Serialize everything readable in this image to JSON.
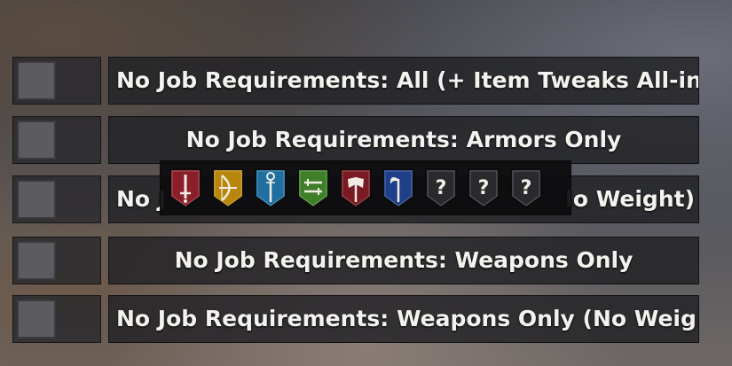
{
  "options": [
    {
      "label": "No Job Requirements: All (+ Item Tweaks All-in-",
      "align": "left",
      "checked": false
    },
    {
      "label": "No Job Requirements: Armors Only",
      "align": "center",
      "checked": false
    },
    {
      "label_left": "No J",
      "label_right": "lo Weight)",
      "checked": false
    },
    {
      "label": "No Job Requirements: Weapons Only",
      "align": "center",
      "checked": false
    },
    {
      "label": "No Job Requirements: Weapons Only (No Weigl",
      "align": "left",
      "checked": false
    }
  ],
  "job_icons": [
    {
      "name": "dagger-icon",
      "color": "#8a1f2a",
      "glyph": "sword",
      "label": ""
    },
    {
      "name": "bow-icon",
      "color": "#b8860b",
      "glyph": "bow",
      "label": ""
    },
    {
      "name": "staff-icon",
      "color": "#1f6fa0",
      "glyph": "staff",
      "label": ""
    },
    {
      "name": "dual-blades-icon",
      "color": "#3f7f2a",
      "glyph": "dual",
      "label": ""
    },
    {
      "name": "axe-icon",
      "color": "#7a1a22",
      "glyph": "axe",
      "label": ""
    },
    {
      "name": "scythe-icon",
      "color": "#1f3f88",
      "glyph": "scythe",
      "label": ""
    },
    {
      "name": "unknown-job-icon",
      "color": "#2a2a2e",
      "glyph": "question",
      "label": "?"
    },
    {
      "name": "unknown-job-icon",
      "color": "#2a2a2e",
      "glyph": "question",
      "label": "?"
    },
    {
      "name": "unknown-job-icon",
      "color": "#2a2a2e",
      "glyph": "question",
      "label": "?"
    }
  ]
}
